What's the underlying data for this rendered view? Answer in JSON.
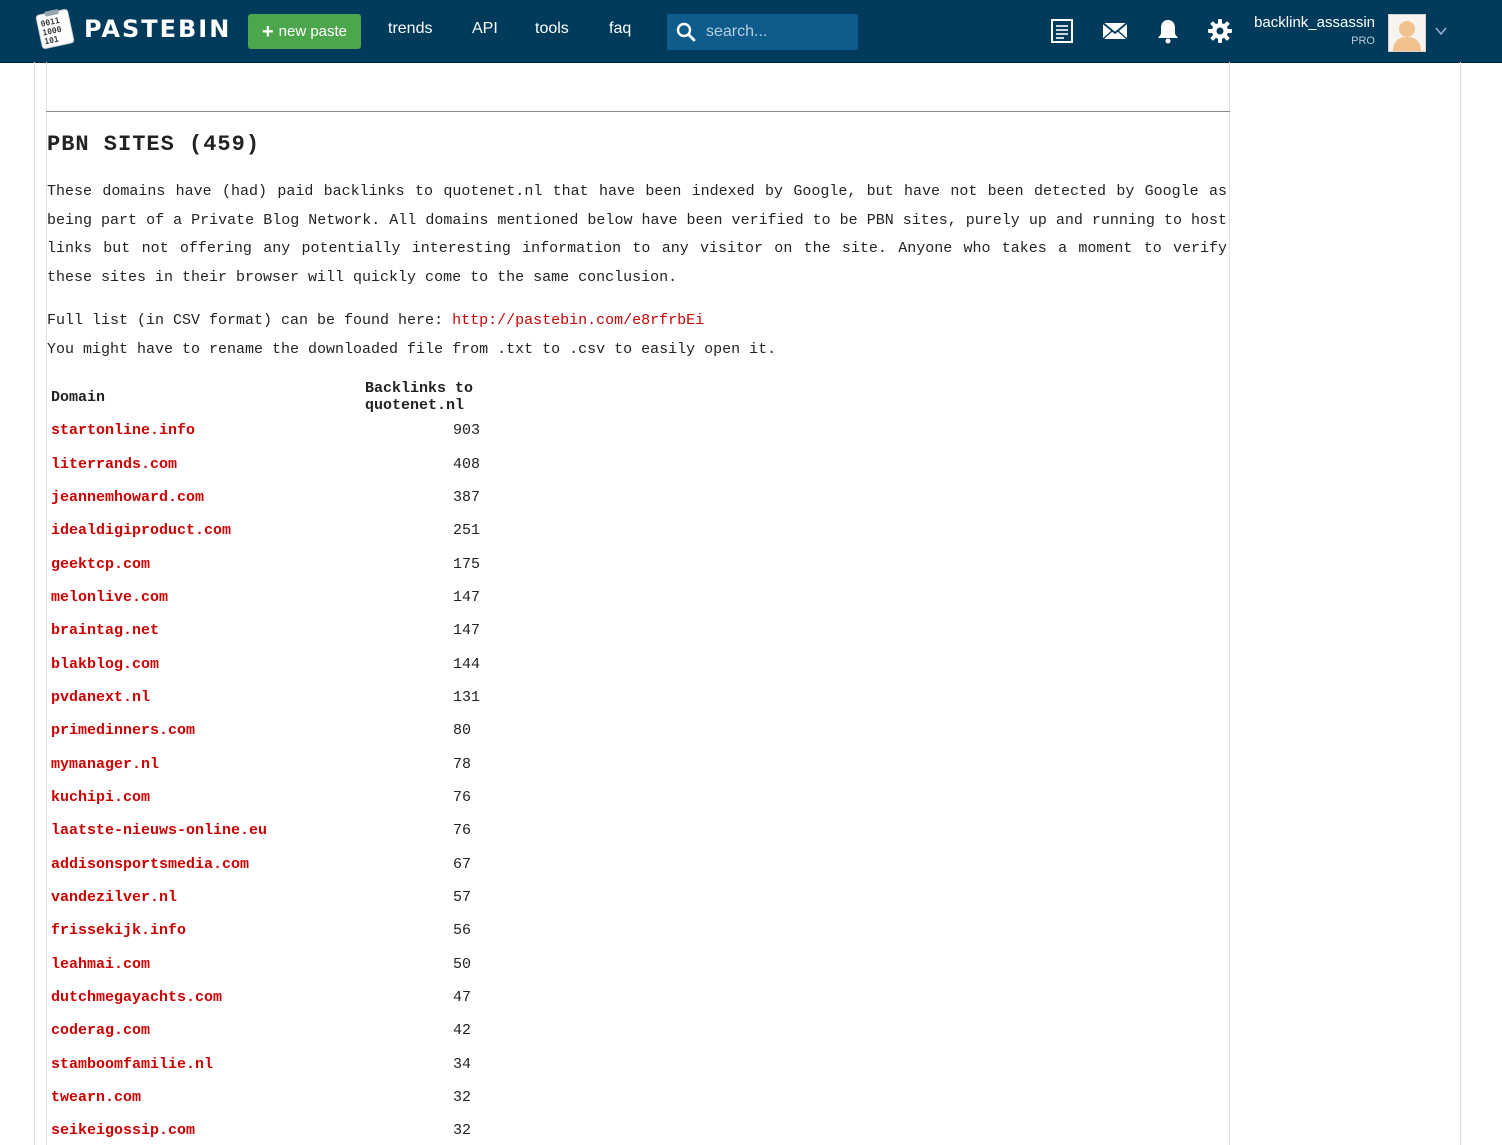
{
  "header": {
    "logo_text": "PASTEBIN",
    "new_paste_label": "new paste",
    "nav": [
      "trends",
      "API",
      "tools",
      "faq"
    ],
    "search_placeholder": "search...",
    "icons": [
      "my-pastes-icon",
      "messages-icon",
      "notifications-icon",
      "settings-icon"
    ],
    "username": "backlink_assassin",
    "badge": "PRO"
  },
  "paste": {
    "title": "PBN SITES (459)",
    "intro": "These domains have (had) paid backlinks to quotenet.nl that have been indexed by Google, but have not been detected by Google as being part of a Private Blog Network. All domains mentioned below have been verified to be PBN sites, purely up and running to host links but not offering any potentially interesting information to any visitor on the site. Anyone who takes a moment to verify these sites in their browser will quickly come to the same conclusion.",
    "csv_prefix": "Full list (in CSV format) can be found here: ",
    "csv_link": "http://pastebin.com/e8rfrbEi",
    "rename_note": "You might have to rename the downloaded file from .txt to .csv to easily open it.",
    "table": {
      "headers": [
        "Domain",
        "Backlinks to quotenet.nl"
      ],
      "rows": [
        {
          "domain": "startonline.info",
          "backlinks": "903"
        },
        {
          "domain": "literrands.com",
          "backlinks": "408"
        },
        {
          "domain": "jeannemhoward.com",
          "backlinks": "387"
        },
        {
          "domain": "idealdigiproduct.com",
          "backlinks": "251"
        },
        {
          "domain": "geektcp.com",
          "backlinks": "175"
        },
        {
          "domain": "melonlive.com",
          "backlinks": "147"
        },
        {
          "domain": "braintag.net",
          "backlinks": "147"
        },
        {
          "domain": "blakblog.com",
          "backlinks": "144"
        },
        {
          "domain": "pvdanext.nl",
          "backlinks": "131"
        },
        {
          "domain": "primedinners.com",
          "backlinks": "80"
        },
        {
          "domain": "mymanager.nl",
          "backlinks": "78"
        },
        {
          "domain": "kuchipi.com",
          "backlinks": "76"
        },
        {
          "domain": "laatste-nieuws-online.eu",
          "backlinks": "76"
        },
        {
          "domain": "addisonsportsmedia.com",
          "backlinks": "67"
        },
        {
          "domain": "vandezilver.nl",
          "backlinks": "57"
        },
        {
          "domain": "frissekijk.info",
          "backlinks": "56"
        },
        {
          "domain": "leahmai.com",
          "backlinks": "50"
        },
        {
          "domain": "dutchmegayachts.com",
          "backlinks": "47"
        },
        {
          "domain": "coderag.com",
          "backlinks": "42"
        },
        {
          "domain": "stamboomfamilie.nl",
          "backlinks": "34"
        },
        {
          "domain": "twearn.com",
          "backlinks": "32"
        },
        {
          "domain": "seikeigossip.com",
          "backlinks": "32"
        }
      ]
    }
  },
  "colors": {
    "header_bg": "#003b5c",
    "new_paste_bg": "#4ca64c",
    "search_bg": "#0e5c8b",
    "link_red": "#cc0000"
  }
}
